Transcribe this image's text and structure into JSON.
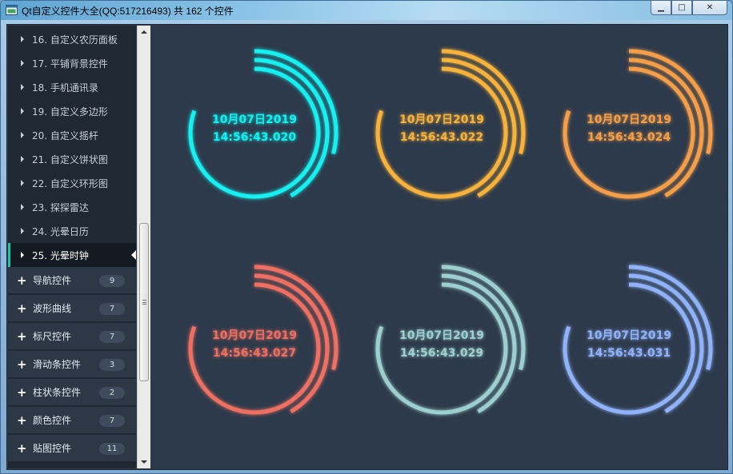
{
  "window": {
    "title": "Qt自定义控件大全(QQ:517216493) 共 162 个控件",
    "buttons": {
      "minimize": "▁",
      "maximize": "□",
      "close": "✕"
    }
  },
  "nav": {
    "items": [
      {
        "label": "16. 自定义农历面板"
      },
      {
        "label": "17. 平铺背景控件"
      },
      {
        "label": "18. 手机通讯录"
      },
      {
        "label": "19. 自定义多边形"
      },
      {
        "label": "20. 自定义摇杆"
      },
      {
        "label": "21. 自定义饼状图"
      },
      {
        "label": "22. 自定义环形图"
      },
      {
        "label": "23. 探探雷达"
      },
      {
        "label": "24. 光晕日历"
      },
      {
        "label": "25. 光晕时钟",
        "active": true
      }
    ],
    "groups": [
      {
        "label": "导航控件",
        "count": "9"
      },
      {
        "label": "波形曲线",
        "count": "7"
      },
      {
        "label": "标尺控件",
        "count": "7"
      },
      {
        "label": "滑动条控件",
        "count": "3"
      },
      {
        "label": "柱状条控件",
        "count": "2"
      },
      {
        "label": "颜色控件",
        "count": "7"
      },
      {
        "label": "贴图控件",
        "count": "11"
      }
    ]
  },
  "clocks": [
    {
      "date": "10月07日2019",
      "time": "14:56:43.020",
      "color": "#12f0f0"
    },
    {
      "date": "10月07日2019",
      "time": "14:56:43.022",
      "color": "#f7b23b"
    },
    {
      "date": "10月07日2019",
      "time": "14:56:43.024",
      "color": "#f59e48"
    },
    {
      "date": "10月07日2019",
      "time": "14:56:43.027",
      "color": "#ee6f62"
    },
    {
      "date": "10月07日2019",
      "time": "14:56:43.029",
      "color": "#9ccfcf"
    },
    {
      "date": "10月07日2019",
      "time": "14:56:43.031",
      "color": "#8fb2f8"
    }
  ],
  "icons": {
    "app": "app-window-icon",
    "nav_arrow": "triangle-right-icon",
    "group_plus": "plus-icon",
    "active_marker": "triangle-left-icon"
  }
}
